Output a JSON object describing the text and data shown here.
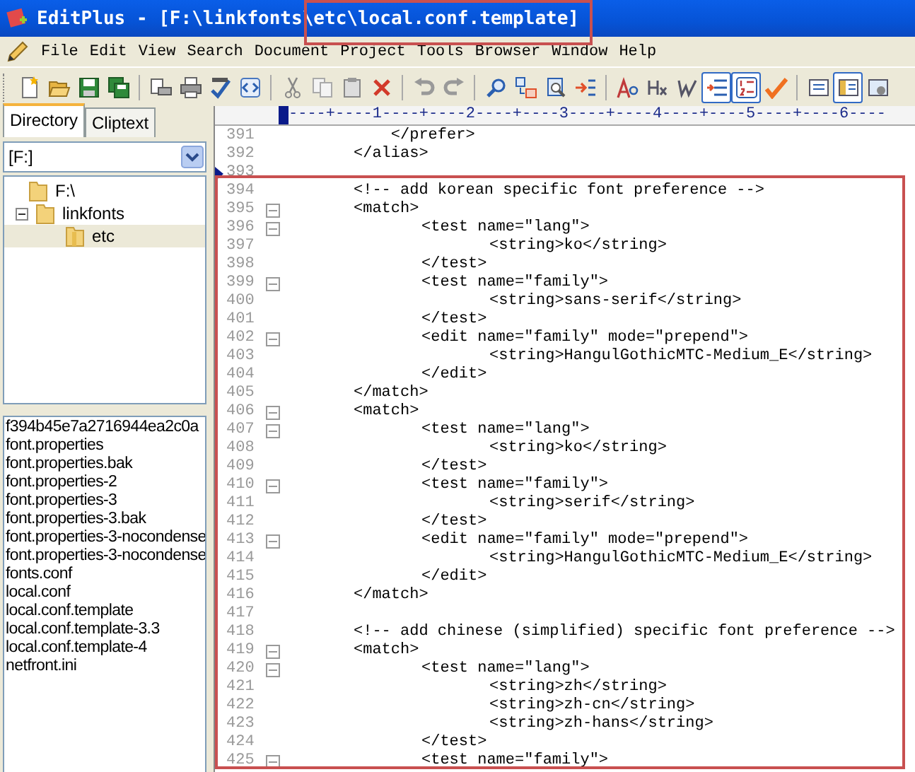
{
  "window": {
    "title": "EditPlus - [F:\\linkfonts\\etc\\local.conf.template]"
  },
  "menu": [
    "File",
    "Edit",
    "View",
    "Search",
    "Document",
    "Project",
    "Tools",
    "Browser",
    "Window",
    "Help"
  ],
  "toolbar": [
    [
      {
        "kind": "new",
        "on": false
      },
      {
        "kind": "open",
        "on": false
      },
      {
        "kind": "save",
        "on": false
      },
      {
        "kind": "saveall",
        "on": false
      }
    ],
    [
      {
        "kind": "preview",
        "on": false
      },
      {
        "kind": "print",
        "on": false
      },
      {
        "kind": "spell",
        "on": false
      },
      {
        "kind": "browser",
        "on": false
      }
    ],
    [
      {
        "kind": "cut",
        "on": false
      },
      {
        "kind": "copy",
        "on": false
      },
      {
        "kind": "paste",
        "on": false
      },
      {
        "kind": "delete",
        "on": false
      }
    ],
    [
      {
        "kind": "undo",
        "on": false
      },
      {
        "kind": "redo",
        "on": false
      }
    ],
    [
      {
        "kind": "find",
        "on": false
      },
      {
        "kind": "replace",
        "on": false
      },
      {
        "kind": "findfiles",
        "on": false
      },
      {
        "kind": "goto",
        "on": false
      }
    ],
    [
      {
        "kind": "font",
        "on": false
      },
      {
        "kind": "hx",
        "on": false
      },
      {
        "kind": "wrap",
        "on": false
      },
      {
        "kind": "indent",
        "on": true
      },
      {
        "kind": "linenum",
        "on": true
      },
      {
        "kind": "check",
        "on": false
      }
    ],
    [
      {
        "kind": "panel",
        "on": false
      },
      {
        "kind": "panel2",
        "on": true
      },
      {
        "kind": "panel3",
        "on": false
      }
    ]
  ],
  "sidebar": {
    "tabs": [
      {
        "label": "Directory",
        "selected": true
      },
      {
        "label": "Cliptext",
        "selected": false
      }
    ],
    "drive": "[F:]",
    "tree": [
      {
        "label": "F:\\",
        "selected": false,
        "children": [
          {
            "label": "linkfonts",
            "expanded": true,
            "selected": false,
            "children": [
              {
                "label": "etc",
                "selected": true
              }
            ]
          }
        ]
      }
    ],
    "files": [
      "f394b45e7a2716944ea2c0a",
      "font.properties",
      "font.properties.bak",
      "font.properties-2",
      "font.properties-3",
      "font.properties-3.bak",
      "font.properties-3-nocondense",
      "font.properties-3-nocondense",
      "fonts.conf",
      "local.conf",
      "local.conf.template",
      "local.conf.template-3.3",
      "local.conf.template-4",
      "netfront.ini"
    ]
  },
  "editor": {
    "ruler": "----+----1----+----2----+----3----+----4----+----5----+----6----",
    "lines": [
      {
        "number": "391",
        "text": "\t    </prefer>",
        "fold": false,
        "bookmark": false
      },
      {
        "number": "392",
        "text": "\t</alias>",
        "fold": false,
        "bookmark": false
      },
      {
        "number": "393",
        "fold": false,
        "bookmark": true
      },
      {
        "number": "394",
        "text": "\t<!-- add korean specific font preference -->",
        "fold": false,
        "bookmark": false
      },
      {
        "number": "395",
        "text": "\t<match>",
        "fold": true,
        "bookmark": false
      },
      {
        "number": "396",
        "text": "\t\t<test name=\"lang\">",
        "fold": true,
        "bookmark": false
      },
      {
        "number": "397",
        "text": "\t\t\t<string>ko</string>",
        "fold": false,
        "bookmark": false
      },
      {
        "number": "398",
        "text": "\t\t</test>",
        "fold": false,
        "bookmark": false
      },
      {
        "number": "399",
        "text": "\t\t<test name=\"family\">",
        "fold": true,
        "bookmark": false
      },
      {
        "number": "400",
        "text": "\t\t\t<string>sans-serif</string>",
        "fold": false,
        "bookmark": false
      },
      {
        "number": "401",
        "text": "\t\t</test>",
        "fold": false,
        "bookmark": false
      },
      {
        "number": "402",
        "text": "\t\t<edit name=\"family\" mode=\"prepend\">",
        "fold": true,
        "bookmark": false
      },
      {
        "number": "403",
        "text": "\t\t\t<string>HangulGothicMTC-Medium_E</string>",
        "fold": false,
        "bookmark": false
      },
      {
        "number": "404",
        "text": "\t\t</edit>",
        "fold": false,
        "bookmark": false
      },
      {
        "number": "405",
        "text": "\t</match>",
        "fold": false,
        "bookmark": false
      },
      {
        "number": "406",
        "text": "\t<match>",
        "fold": true,
        "bookmark": false
      },
      {
        "number": "407",
        "text": "\t\t<test name=\"lang\">",
        "fold": true,
        "bookmark": false
      },
      {
        "number": "408",
        "text": "\t\t\t<string>ko</string>",
        "fold": false,
        "bookmark": false
      },
      {
        "number": "409",
        "text": "\t\t</test>",
        "fold": false,
        "bookmark": false
      },
      {
        "number": "410",
        "text": "\t\t<test name=\"family\">",
        "fold": true,
        "bookmark": false
      },
      {
        "number": "411",
        "text": "\t\t\t<string>serif</string>",
        "fold": false,
        "bookmark": false
      },
      {
        "number": "412",
        "text": "\t\t</test>",
        "fold": false,
        "bookmark": false
      },
      {
        "number": "413",
        "text": "\t\t<edit name=\"family\" mode=\"prepend\">",
        "fold": true,
        "bookmark": false
      },
      {
        "number": "414",
        "text": "\t\t\t<string>HangulGothicMTC-Medium_E</string>",
        "fold": false,
        "bookmark": false
      },
      {
        "number": "415",
        "text": "\t\t</edit>",
        "fold": false,
        "bookmark": false
      },
      {
        "number": "416",
        "text": "\t</match>",
        "fold": false,
        "bookmark": false
      },
      {
        "number": "417",
        "fold": false,
        "bookmark": false
      },
      {
        "number": "418",
        "text": "\t<!-- add chinese (simplified) specific font preference -->",
        "fold": false,
        "bookmark": false
      },
      {
        "number": "419",
        "text": "\t<match>",
        "fold": true,
        "bookmark": false
      },
      {
        "number": "420",
        "text": "\t\t<test name=\"lang\">",
        "fold": true,
        "bookmark": false
      },
      {
        "number": "421",
        "text": "\t\t\t<string>zh</string>",
        "fold": false,
        "bookmark": false
      },
      {
        "number": "422",
        "text": "\t\t\t<string>zh-cn</string>",
        "fold": false,
        "bookmark": false
      },
      {
        "number": "423",
        "text": "\t\t\t<string>zh-hans</string>",
        "fold": false,
        "bookmark": false
      },
      {
        "number": "424",
        "text": "\t\t</test>",
        "fold": false,
        "bookmark": false
      },
      {
        "number": "425",
        "text": "\t\t<test name=\"family\">",
        "fold": true,
        "bookmark": false
      }
    ]
  }
}
